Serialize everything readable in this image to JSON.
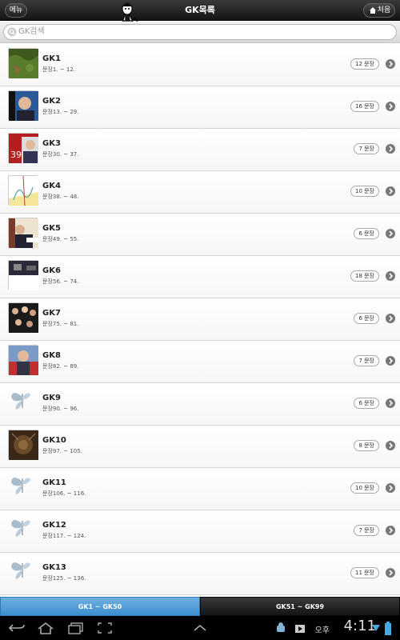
{
  "header": {
    "menu_label": "메뉴",
    "title": "GK목록",
    "home_label": "처음"
  },
  "search": {
    "placeholder": "GK검색"
  },
  "list": [
    {
      "title": "GK1",
      "range": "문장1. ~ 12.",
      "count": "12 문장",
      "thumb": "green-map"
    },
    {
      "title": "GK2",
      "range": "문장13. ~ 29.",
      "count": "16 문장",
      "thumb": "man-blue"
    },
    {
      "title": "GK3",
      "range": "문장30. ~ 37.",
      "count": "7 문장",
      "thumb": "red-39"
    },
    {
      "title": "GK4",
      "range": "문장38. ~ 48.",
      "count": "10 문장",
      "thumb": "graph-yellow"
    },
    {
      "title": "GK5",
      "range": "문장49. ~ 55.",
      "count": "6 문장",
      "thumb": "man-desk"
    },
    {
      "title": "GK6",
      "range": "문장56. ~ 74.",
      "count": "18 문장",
      "thumb": "dark-room"
    },
    {
      "title": "GK7",
      "range": "문장75. ~ 81.",
      "count": "6 문장",
      "thumb": "crowd"
    },
    {
      "title": "GK8",
      "range": "문장82. ~ 89.",
      "count": "7 문장",
      "thumb": "man-flag"
    },
    {
      "title": "GK9",
      "range": "문장90. ~ 96.",
      "count": "6 문장",
      "thumb": "butterfly"
    },
    {
      "title": "GK10",
      "range": "문장97. ~ 105.",
      "count": "8 문장",
      "thumb": "brown-art"
    },
    {
      "title": "GK11",
      "range": "문장106. ~ 116.",
      "count": "10 문장",
      "thumb": "butterfly"
    },
    {
      "title": "GK12",
      "range": "문장117. ~ 124.",
      "count": "7 문장",
      "thumb": "butterfly"
    },
    {
      "title": "GK13",
      "range": "문장125. ~ 136.",
      "count": "11 문장",
      "thumb": "butterfly"
    }
  ],
  "tabs": {
    "tab1": "GK1 ~ GK50",
    "tab2": "GK51 ~ GK99"
  },
  "system": {
    "ampm": "오후",
    "time": "4:11"
  },
  "colors": {
    "active_tab": "#4a9ad6",
    "topbar": "#1e1e1e"
  }
}
